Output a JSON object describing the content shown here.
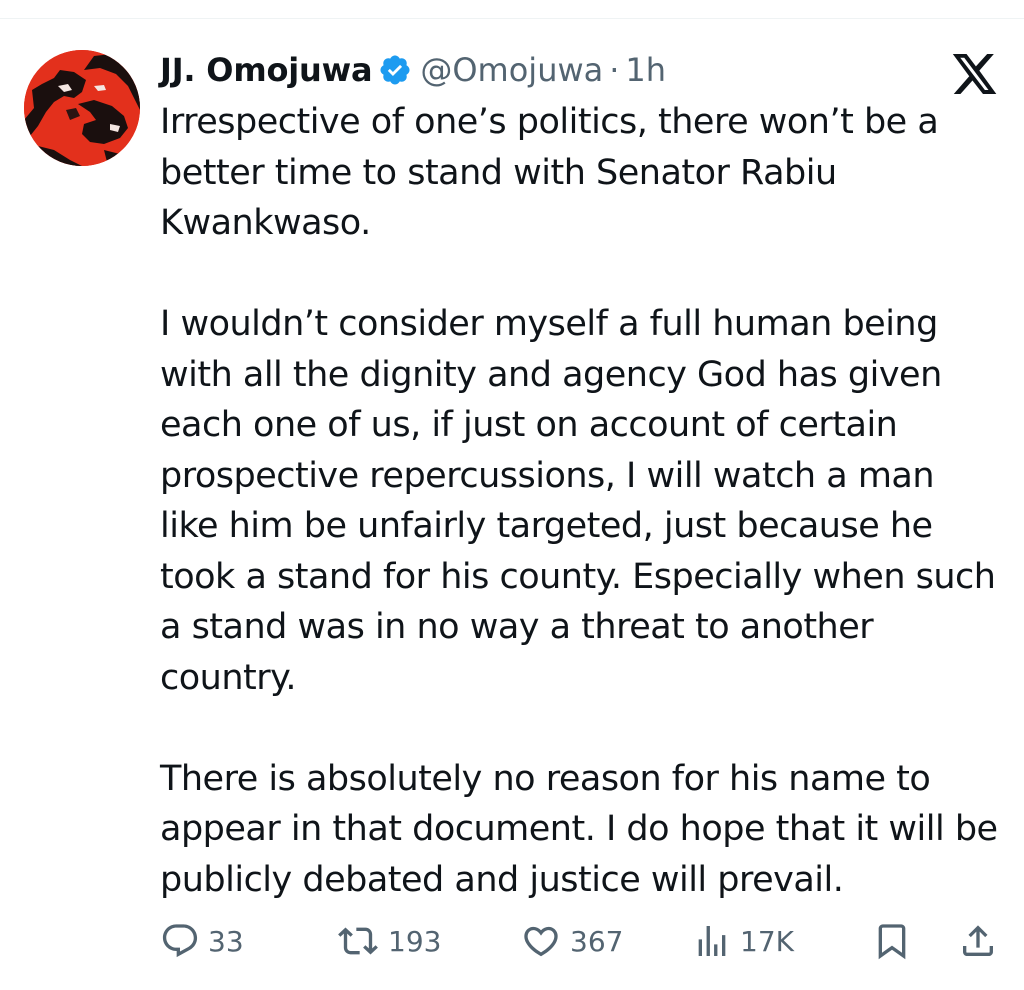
{
  "author": {
    "display_name": "JJ. Omojuwa",
    "handle": "@Omojuwa",
    "separator": "·",
    "time_ago": "1h",
    "avatar_icon": "profile-photo",
    "verified_icon": "verified-badge-icon",
    "verified_color": "#1d9bf0"
  },
  "platform": {
    "logo_icon": "x-logo-icon"
  },
  "tweet": {
    "paragraphs": [
      "Irrespective of one’s politics, there won’t be a better time to stand with Senator Rabiu Kwankwaso.",
      "I wouldn’t consider myself a full human being with all the dignity and agency God has given each one of us, if just on account of certain prospective repercussions, I will watch a man like him be unfairly targeted, just because he took a stand for his county. Especially when such a stand was in no way a threat to another country.",
      "There is absolutely no reason for his name to appear in that document. I do hope that it will be publicly debated and justice will prevail."
    ]
  },
  "actions": {
    "replies": "33",
    "reposts": "193",
    "likes": "367",
    "views": "17K",
    "icons": [
      "reply-icon",
      "retweet-icon",
      "like-icon",
      "views-icon",
      "bookmark-icon",
      "share-icon"
    ]
  },
  "colors": {
    "text": "#0f1419",
    "secondary": "#536471",
    "avatar_bg": "#e3301c"
  }
}
